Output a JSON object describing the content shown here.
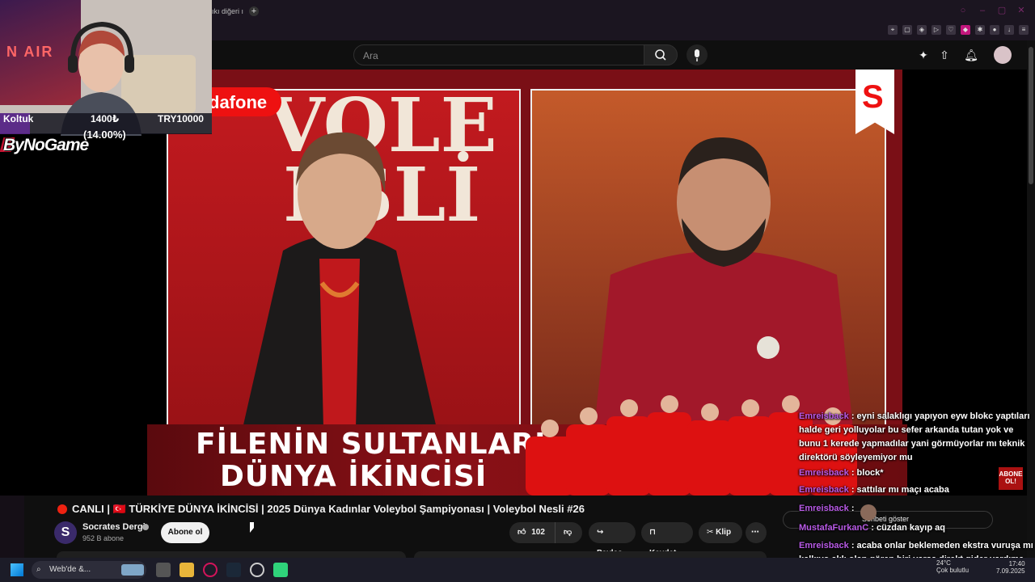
{
  "browser": {
    "tab_label": "ıkı diğeri ı",
    "new_tab": "+"
  },
  "youtube": {
    "search_placeholder": "Ara",
    "video_title": "CANLI | 🇹🇷 TÜRKİYE DÜNYA İKİNCİSİ | 2025 Dünya Kadınlar Voleybol Şampiyonası | Voleybol Nesli #26",
    "title_flag": "TR",
    "channel_name": "Socrates Dergi",
    "channel_initial": "S",
    "subscribers": "952 B abone",
    "subscribe_label": "Abone ol",
    "likes": "102",
    "share_label": "Paylaş",
    "save_label": "Kaydet",
    "clip_label": "Klip",
    "more_label": "⋯"
  },
  "video": {
    "sponsor": "dafone",
    "set_text_line1": "VOLE",
    "set_text_line2": "ESLİ",
    "banner_line1": "FİLENİN SULTANLARI",
    "banner_line2": "DÜNYA İKİNCİSİ",
    "logo_letter": "S",
    "badge_line1": "ABONE",
    "badge_line2": "OL!"
  },
  "stream_overlay": {
    "webcam_poster_text": "N AIR",
    "donation_label": "Koltuk",
    "donation_current": "1400₺",
    "donation_goal": "TRY10000",
    "donation_percent": "(14.00%)",
    "progress_fraction": 0.14,
    "brand": "ByNoGame"
  },
  "chat": {
    "messages": [
      {
        "nick": "Emreisback",
        "text": "eyni salaklıgı yapıyon eyw blokc yaptıları halde geri yolluyolar bu sefer arkanda tutan yok ve bunu 1 kerede yapmadılar yani görmüyorlar mı teknik direktörü söyleyemiyor mu"
      },
      {
        "nick": "Emreisback",
        "text": "block*"
      },
      {
        "nick": "Emreisback",
        "text": "sattılar mı maçı acaba"
      },
      {
        "nick": "Emreisback",
        "text": ""
      },
      {
        "nick": "MustafaFurkanC",
        "text": "cüzdan kayıp aq"
      },
      {
        "nick": "Emreisback",
        "text": "acaba onlar beklemeden ekstra vuruşa mı kalkıyo aklı olan gören biri varsa direkt gider yardıma de düşünürm"
      }
    ],
    "show_chat": "Sohbeti göster"
  },
  "taskbar": {
    "search_text": "Web'de &...",
    "weather_temp": "24°C",
    "weather_desc": "Çok bulutlu",
    "time": "17:40",
    "date": "7.09.2025"
  }
}
